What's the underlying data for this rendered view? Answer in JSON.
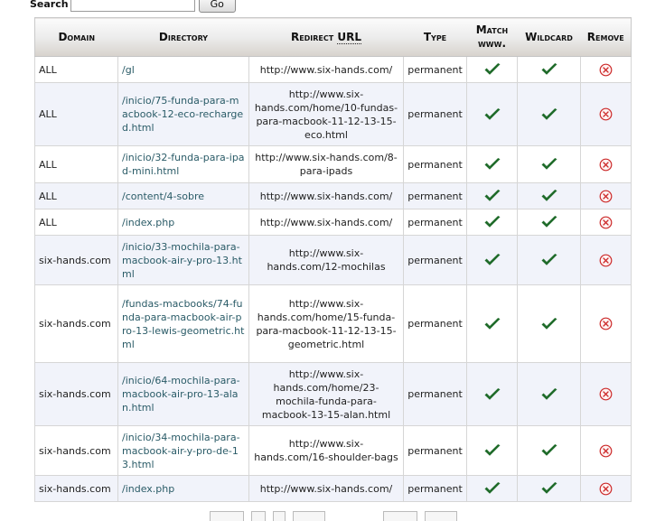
{
  "search": {
    "label": "Search",
    "value": "",
    "button": "Go"
  },
  "table": {
    "headers": {
      "domain": "Domain",
      "directory": "Directory",
      "redirect_prefix": "Redirect ",
      "redirect_abbr": "URL",
      "type": "Type",
      "match_line1": "Match",
      "match_line2": "www.",
      "wildcard": "Wildcard",
      "remove": "Remove"
    },
    "rows": [
      {
        "domain": "ALL",
        "directory": "/gl",
        "url": "http://www.six-hands.com/",
        "type": "permanent",
        "match": true,
        "wildcard": true
      },
      {
        "domain": "ALL",
        "directory": "/inicio/75-funda-para-macbook-12-eco-recharged.html",
        "url": "http://www.six-hands.com/home/10-fundas-para-macbook-11-12-13-15-eco.html",
        "type": "permanent",
        "match": true,
        "wildcard": true
      },
      {
        "domain": "ALL",
        "directory": "/inicio/32-funda-para-ipad-mini.html",
        "url": "http://www.six-hands.com/8-para-ipads",
        "type": "permanent",
        "match": true,
        "wildcard": true
      },
      {
        "domain": "ALL",
        "directory": "/content/4-sobre",
        "url": "http://www.six-hands.com/",
        "type": "permanent",
        "match": true,
        "wildcard": true
      },
      {
        "domain": "ALL",
        "directory": "/index.php",
        "url": "http://www.six-hands.com/",
        "type": "permanent",
        "match": true,
        "wildcard": true
      },
      {
        "domain": "six-hands.com",
        "directory": "/inicio/33-mochila-para-macbook-air-y-pro-13.html",
        "url": "http://www.six-hands.com/12-mochilas",
        "type": "permanent",
        "match": true,
        "wildcard": true
      },
      {
        "domain": "six-hands.com",
        "directory": "/fundas-macbooks/74-funda-para-macbook-air-pro-13-lewis-geometric.html",
        "url": "http://www.six-hands.com/home/15-funda-para-macbook-11-12-13-15-geometric.html",
        "type": "permanent",
        "match": true,
        "wildcard": true
      },
      {
        "domain": "six-hands.com",
        "directory": "/inicio/64-mochila-para-macbook-air-pro-13-alan.html",
        "url": "http://www.six-hands.com/home/23-mochila-funda-para-macbook-13-15-alan.html",
        "type": "permanent",
        "match": true,
        "wildcard": true
      },
      {
        "domain": "six-hands.com",
        "directory": "/inicio/34-mochila-para-macbook-air-y-pro-de-13.html",
        "url": "http://www.six-hands.com/16-shoulder-bags",
        "type": "permanent",
        "match": true,
        "wildcard": true
      },
      {
        "domain": "six-hands.com",
        "directory": "/index.php",
        "url": "http://www.six-hands.com/",
        "type": "permanent",
        "match": true,
        "wildcard": true
      }
    ]
  },
  "icons": {
    "check": "check-icon",
    "remove": "remove-icon"
  },
  "colors": {
    "check": "#1f6b2a",
    "remove": "#cc2a2a",
    "directory_text": "#2a5b67",
    "row_alt": "#f1f3fa"
  }
}
